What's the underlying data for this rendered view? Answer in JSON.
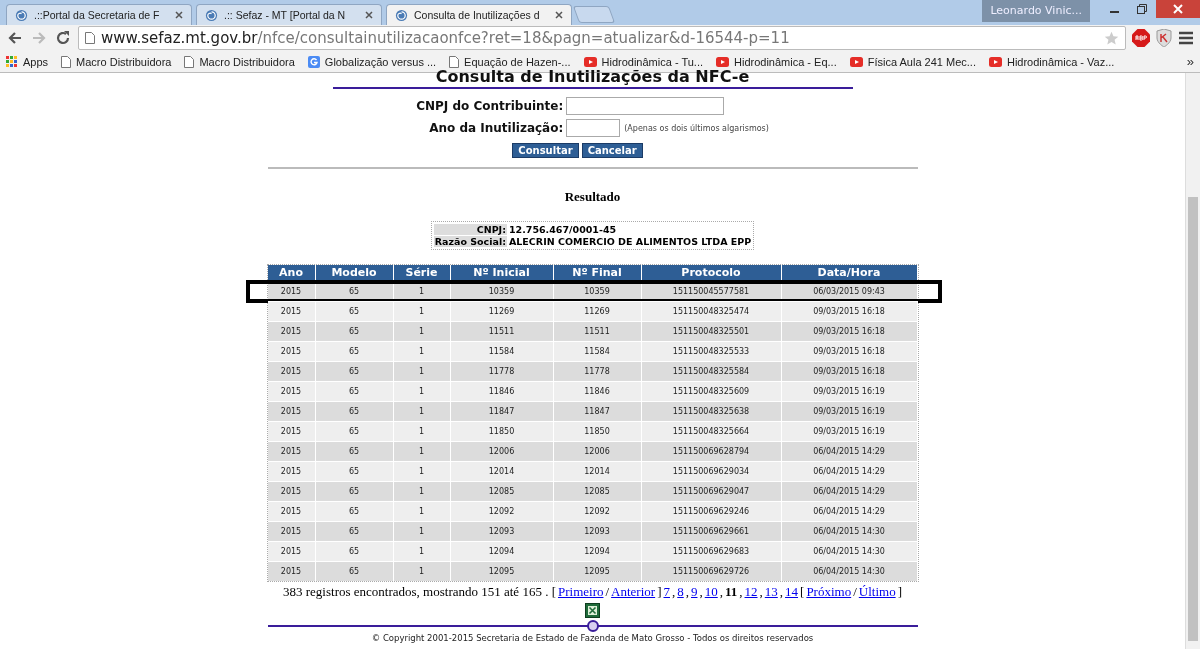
{
  "browser": {
    "tabs": [
      {
        "title": ".::Portal da Secretaria de F",
        "selected": false
      },
      {
        "title": ".:: Sefaz - MT [Portal da N",
        "selected": false
      },
      {
        "title": "Consulta de Inutilizações d",
        "selected": true
      }
    ],
    "user": "Leonardo Vinic...",
    "url_host": "www.sefaz.mt.gov.br",
    "url_path": "/nfce/consultainutilizacaonfce?ret=18&pagn=atualizar&d-16544-p=11",
    "bookmarks": [
      {
        "label": "Apps",
        "kind": "apps"
      },
      {
        "label": "Macro Distribuidora",
        "kind": "page"
      },
      {
        "label": "Macro Distribuidora",
        "kind": "page"
      },
      {
        "label": "Globalização versus ...",
        "kind": "google"
      },
      {
        "label": "Equação de Hazen-...",
        "kind": "page"
      },
      {
        "label": "Hidrodinâmica - Tu...",
        "kind": "video"
      },
      {
        "label": "Hidrodinâmica - Eq...",
        "kind": "video"
      },
      {
        "label": "Física Aula 241 Mec...",
        "kind": "video"
      },
      {
        "label": "Hidrodinâmica - Vaz...",
        "kind": "video"
      }
    ],
    "bookmarks_more": "»"
  },
  "page": {
    "title": "Consulta de Inutilizações da NFC-e",
    "form": {
      "fields": [
        {
          "label": "CNPJ do Contribuinte:",
          "kind": "wide"
        },
        {
          "label": "Ano da Inutilização:",
          "kind": "short",
          "hint": "(Apenas os dois últimos algarismos)"
        }
      ],
      "buttons": [
        "Consultar",
        "Cancelar"
      ]
    },
    "result_heading": "Resultado",
    "info": [
      {
        "label": "CNPJ:",
        "value": "12.756.467/0001-45"
      },
      {
        "label": "Razão Social:",
        "value": "ALECRIN COMERCIO DE ALIMENTOS LTDA EPP"
      }
    ],
    "table": {
      "columns": [
        "Ano",
        "Modelo",
        "Série",
        "Nº Inicial",
        "Nº Final",
        "Protocolo",
        "Data/Hora"
      ],
      "rows": [
        {
          "cells": [
            "2015",
            "65",
            "1",
            "10359",
            "10359",
            "151150045577581",
            "06/03/2015 09:43"
          ],
          "highlighted": true
        },
        {
          "cells": [
            "2015",
            "65",
            "1",
            "11269",
            "11269",
            "151150048325474",
            "09/03/2015 16:18"
          ],
          "highlighted": false
        },
        {
          "cells": [
            "2015",
            "65",
            "1",
            "11511",
            "11511",
            "151150048325501",
            "09/03/2015 16:18"
          ],
          "highlighted": false
        },
        {
          "cells": [
            "2015",
            "65",
            "1",
            "11584",
            "11584",
            "151150048325533",
            "09/03/2015 16:18"
          ],
          "highlighted": false
        },
        {
          "cells": [
            "2015",
            "65",
            "1",
            "11778",
            "11778",
            "151150048325584",
            "09/03/2015 16:18"
          ],
          "highlighted": false
        },
        {
          "cells": [
            "2015",
            "65",
            "1",
            "11846",
            "11846",
            "151150048325609",
            "09/03/2015 16:19"
          ],
          "highlighted": false
        },
        {
          "cells": [
            "2015",
            "65",
            "1",
            "11847",
            "11847",
            "151150048325638",
            "09/03/2015 16:19"
          ],
          "highlighted": false
        },
        {
          "cells": [
            "2015",
            "65",
            "1",
            "11850",
            "11850",
            "151150048325664",
            "09/03/2015 16:19"
          ],
          "highlighted": false
        },
        {
          "cells": [
            "2015",
            "65",
            "1",
            "12006",
            "12006",
            "151150069628794",
            "06/04/2015 14:29"
          ],
          "highlighted": false
        },
        {
          "cells": [
            "2015",
            "65",
            "1",
            "12014",
            "12014",
            "151150069629034",
            "06/04/2015 14:29"
          ],
          "highlighted": false
        },
        {
          "cells": [
            "2015",
            "65",
            "1",
            "12085",
            "12085",
            "151150069629047",
            "06/04/2015 14:29"
          ],
          "highlighted": false
        },
        {
          "cells": [
            "2015",
            "65",
            "1",
            "12092",
            "12092",
            "151150069629246",
            "06/04/2015 14:29"
          ],
          "highlighted": false
        },
        {
          "cells": [
            "2015",
            "65",
            "1",
            "12093",
            "12093",
            "151150069629661",
            "06/04/2015 14:30"
          ],
          "highlighted": false
        },
        {
          "cells": [
            "2015",
            "65",
            "1",
            "12094",
            "12094",
            "151150069629683",
            "06/04/2015 14:30"
          ],
          "highlighted": false
        },
        {
          "cells": [
            "2015",
            "65",
            "1",
            "12095",
            "12095",
            "151150069629726",
            "06/04/2015 14:30"
          ],
          "highlighted": false
        }
      ]
    },
    "pagination": [
      {
        "kind": "text",
        "text": "383 registros encontrados, mostrando 151 até 165 . ["
      },
      {
        "kind": "link",
        "text": "Primeiro"
      },
      {
        "kind": "text",
        "text": "/"
      },
      {
        "kind": "link",
        "text": "Anterior"
      },
      {
        "kind": "text",
        "text": "]"
      },
      {
        "kind": "link",
        "text": "7"
      },
      {
        "kind": "text",
        "text": ","
      },
      {
        "kind": "link",
        "text": "8"
      },
      {
        "kind": "text",
        "text": ","
      },
      {
        "kind": "link",
        "text": "9"
      },
      {
        "kind": "text",
        "text": ","
      },
      {
        "kind": "link",
        "text": "10"
      },
      {
        "kind": "text",
        "text": ","
      },
      {
        "kind": "current",
        "text": "11"
      },
      {
        "kind": "text",
        "text": ","
      },
      {
        "kind": "link",
        "text": "12"
      },
      {
        "kind": "text",
        "text": ","
      },
      {
        "kind": "link",
        "text": "13"
      },
      {
        "kind": "text",
        "text": ","
      },
      {
        "kind": "link",
        "text": "14"
      },
      {
        "kind": "text",
        "text": "["
      },
      {
        "kind": "link",
        "text": "Próximo"
      },
      {
        "kind": "text",
        "text": "/"
      },
      {
        "kind": "link",
        "text": "Último"
      },
      {
        "kind": "text",
        "text": "]"
      }
    ],
    "copyright": "© Copyright 2001-2015 Secretaria de Estado de Fazenda de Mato Grosso - Todos os direitos reservados"
  }
}
